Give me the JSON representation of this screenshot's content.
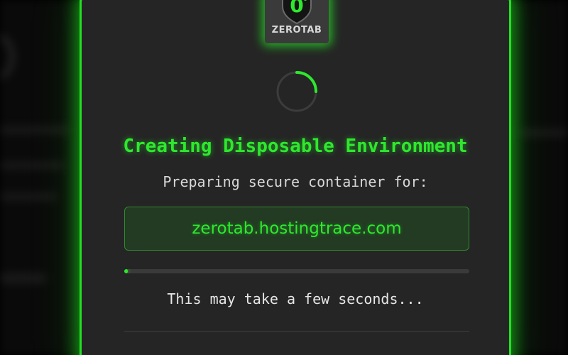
{
  "modal": {
    "logo_text": "ZEROTAB",
    "logo_glyph": "0",
    "title": "Creating Disposable Environment",
    "subtitle": "Preparing secure container for:",
    "domain": "zerotab.hostingtrace.com",
    "progress_percent": 1,
    "note": "This may take a few seconds..."
  },
  "colors": {
    "accent": "#2ee82e",
    "panel": "#252525",
    "domain_box_bg": "#233a23",
    "text": "#d8d8d8"
  },
  "icons": [
    "shield-logo-icon",
    "loading-spinner-icon"
  ]
}
